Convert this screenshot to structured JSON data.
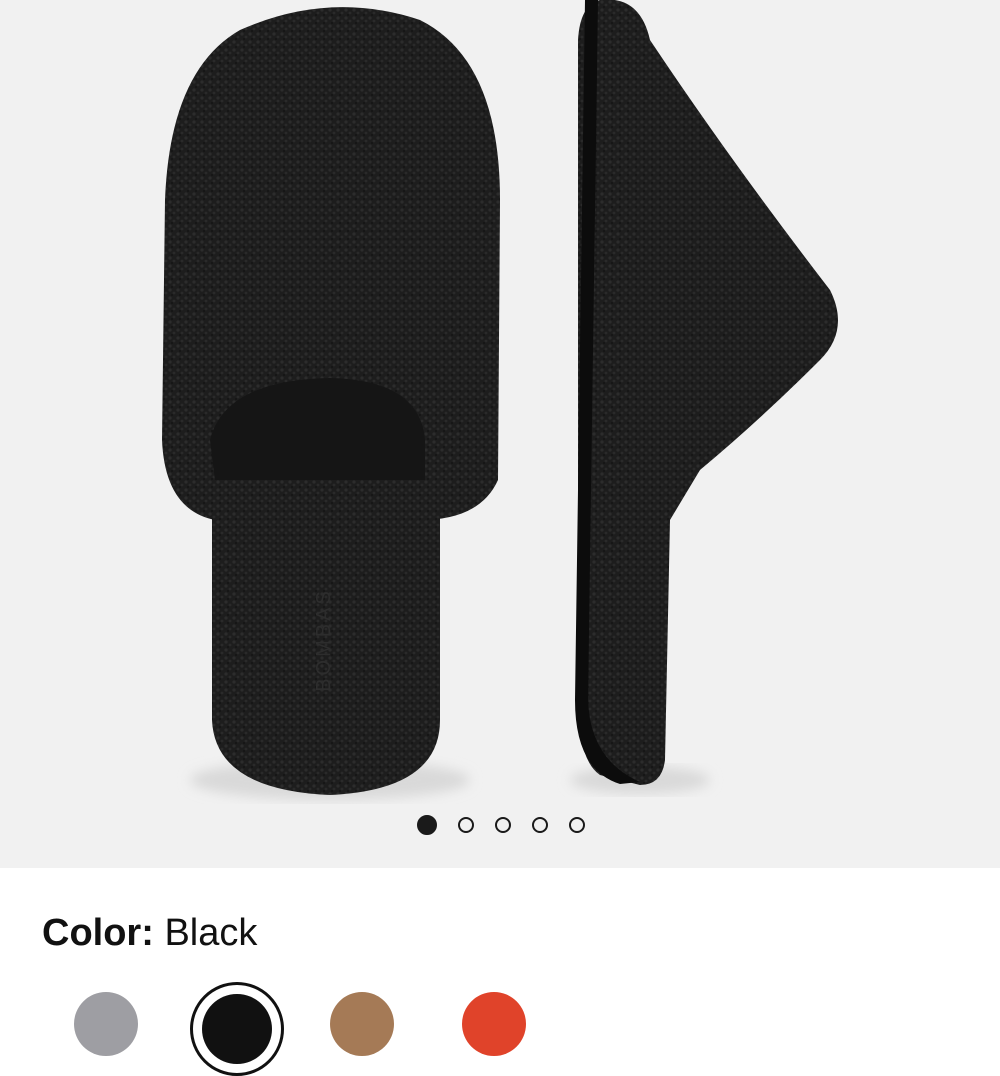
{
  "product_image": {
    "alt": "Black sherpa slipper shown top view and side view",
    "brand_mark": "BOMBAS"
  },
  "carousel": {
    "total": 5,
    "active_index": 0
  },
  "color_selector": {
    "label": "Color:",
    "selected": "Black",
    "swatches": [
      {
        "name": "Grey",
        "color": "#9e9ea3"
      },
      {
        "name": "Black",
        "color": "#111111",
        "selected": true
      },
      {
        "name": "Tan",
        "color": "#a57a56"
      },
      {
        "name": "Red",
        "color": "#e0432a"
      }
    ]
  }
}
